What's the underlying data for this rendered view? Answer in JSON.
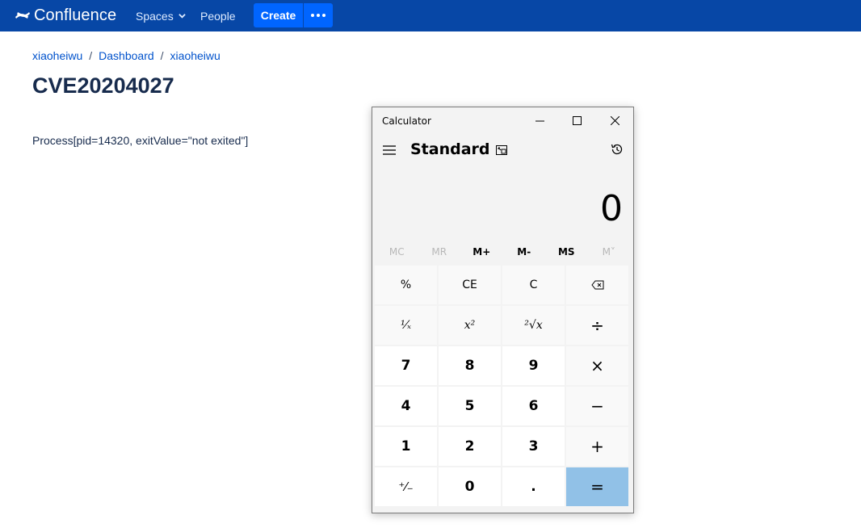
{
  "nav": {
    "logo_text": "Confluence",
    "spaces": "Spaces",
    "people": "People",
    "create": "Create",
    "colors": {
      "bar": "#0747a6",
      "button": "#0065ff"
    }
  },
  "breadcrumb": [
    "xiaoheiwu",
    "Dashboard",
    "xiaoheiwu"
  ],
  "breadcrumb_sep": "/",
  "page": {
    "title": "CVE20204027",
    "body": "Process[pid=14320, exitValue=\"not exited\"]"
  },
  "calculator": {
    "window_title": "Calculator",
    "mode": "Standard",
    "display": "0",
    "memory": [
      {
        "label": "MC",
        "enabled": false
      },
      {
        "label": "MR",
        "enabled": false
      },
      {
        "label": "M+",
        "enabled": true
      },
      {
        "label": "M-",
        "enabled": true
      },
      {
        "label": "MS",
        "enabled": true
      },
      {
        "label": "M˅",
        "enabled": false
      }
    ],
    "keys": [
      [
        "%",
        "CE",
        "C",
        "⌫"
      ],
      [
        "¹⁄ₓ",
        "x²",
        "²√x",
        "÷"
      ],
      [
        "7",
        "8",
        "9",
        "×"
      ],
      [
        "4",
        "5",
        "6",
        "−"
      ],
      [
        "1",
        "2",
        "3",
        "+"
      ],
      [
        "⁺⁄₋",
        "0",
        ".",
        "="
      ]
    ],
    "equals_color": "#91c1e7"
  }
}
